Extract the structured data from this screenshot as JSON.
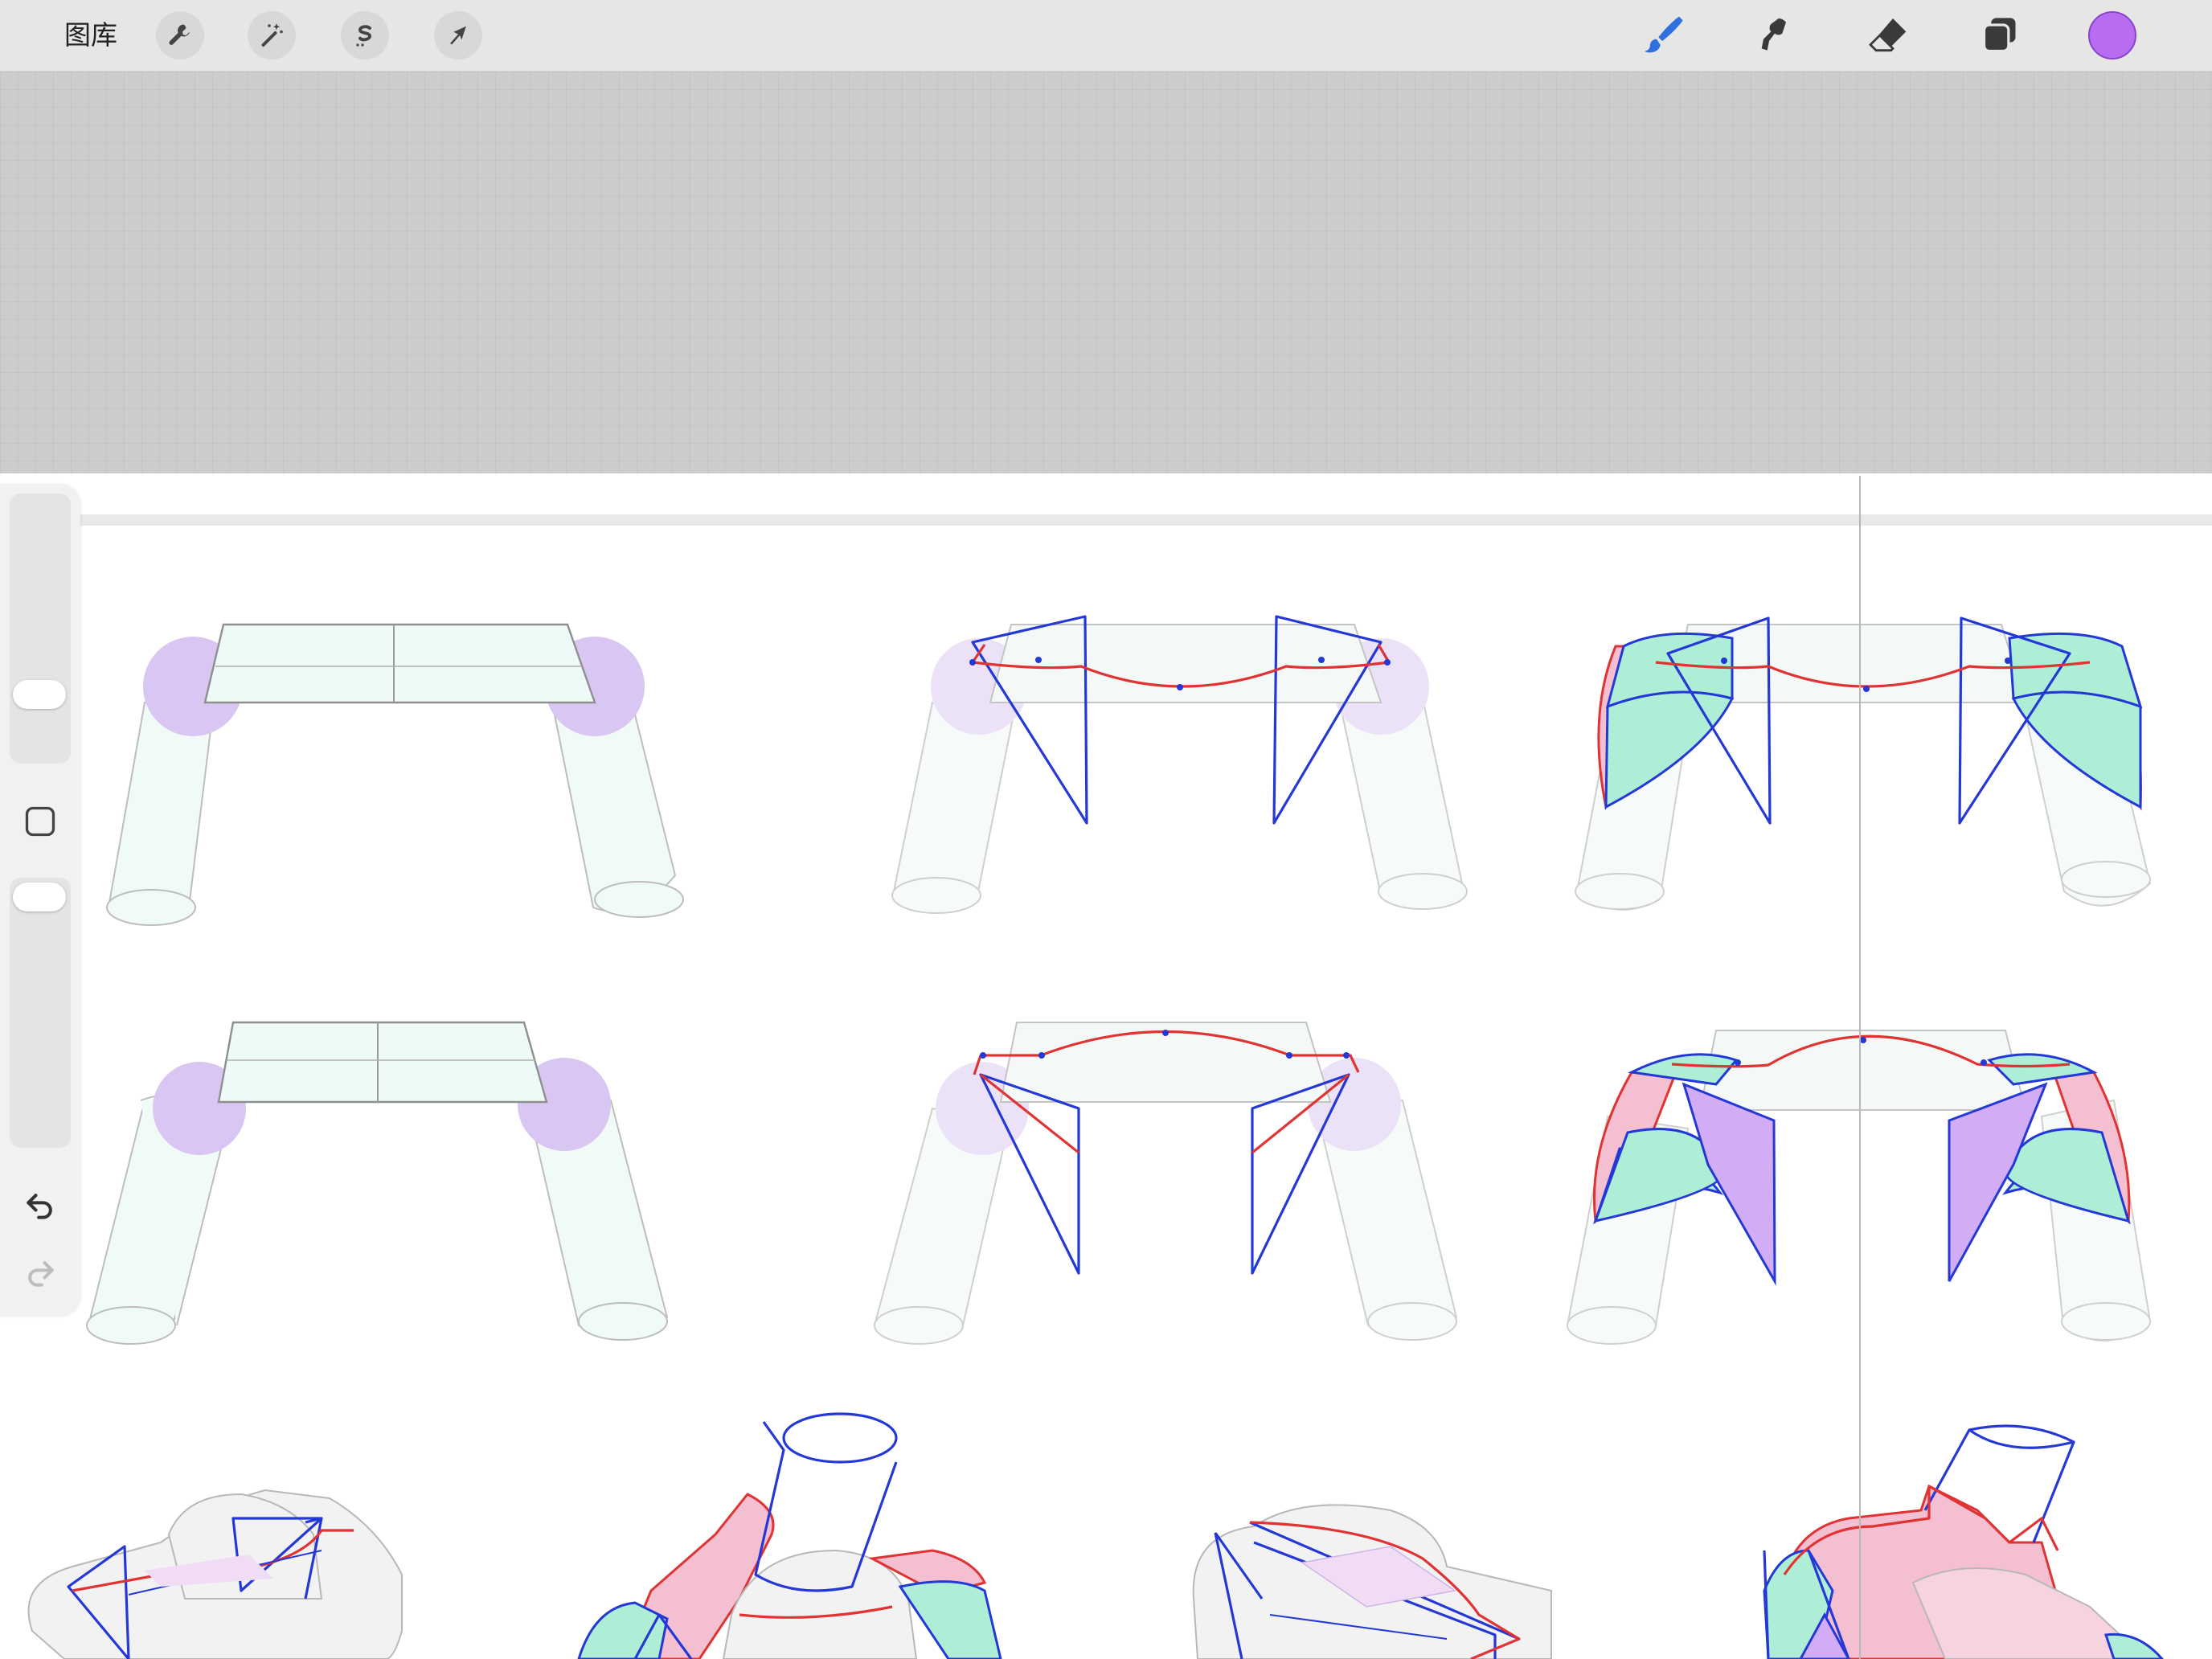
{
  "toolbar": {
    "gallery_label": "图库",
    "left_tools": [
      {
        "name": "actions",
        "icon": "wrench-icon"
      },
      {
        "name": "adjustments",
        "icon": "magic-wand-icon"
      },
      {
        "name": "selection",
        "icon": "selection-s-icon"
      },
      {
        "name": "transform",
        "icon": "arrow-cursor-icon"
      }
    ],
    "right_tools": [
      {
        "name": "brush",
        "icon": "brush-icon",
        "active": true
      },
      {
        "name": "smudge",
        "icon": "smudge-icon"
      },
      {
        "name": "eraser",
        "icon": "eraser-icon"
      },
      {
        "name": "layers",
        "icon": "layers-icon"
      }
    ],
    "current_color": "#b86cf2",
    "active_tool_color": "#2f6fe0"
  },
  "sidebar": {
    "brush_size_slider": {
      "value": 0.1
    },
    "modify_button": {
      "icon": "square-modify-icon"
    },
    "opacity_slider": {
      "value": 0.95
    },
    "undo": {
      "icon": "undo-icon"
    },
    "redo": {
      "icon": "redo-icon",
      "enabled": false
    }
  },
  "canvas": {
    "background": "#ffffff",
    "outside_background": "#cbccce",
    "sketch_colors": {
      "blue": "#2438d6",
      "red": "#e03333",
      "purple": "#d7c6f2",
      "teal": "#a8ecd4",
      "pink": "#f4b8cc"
    }
  }
}
